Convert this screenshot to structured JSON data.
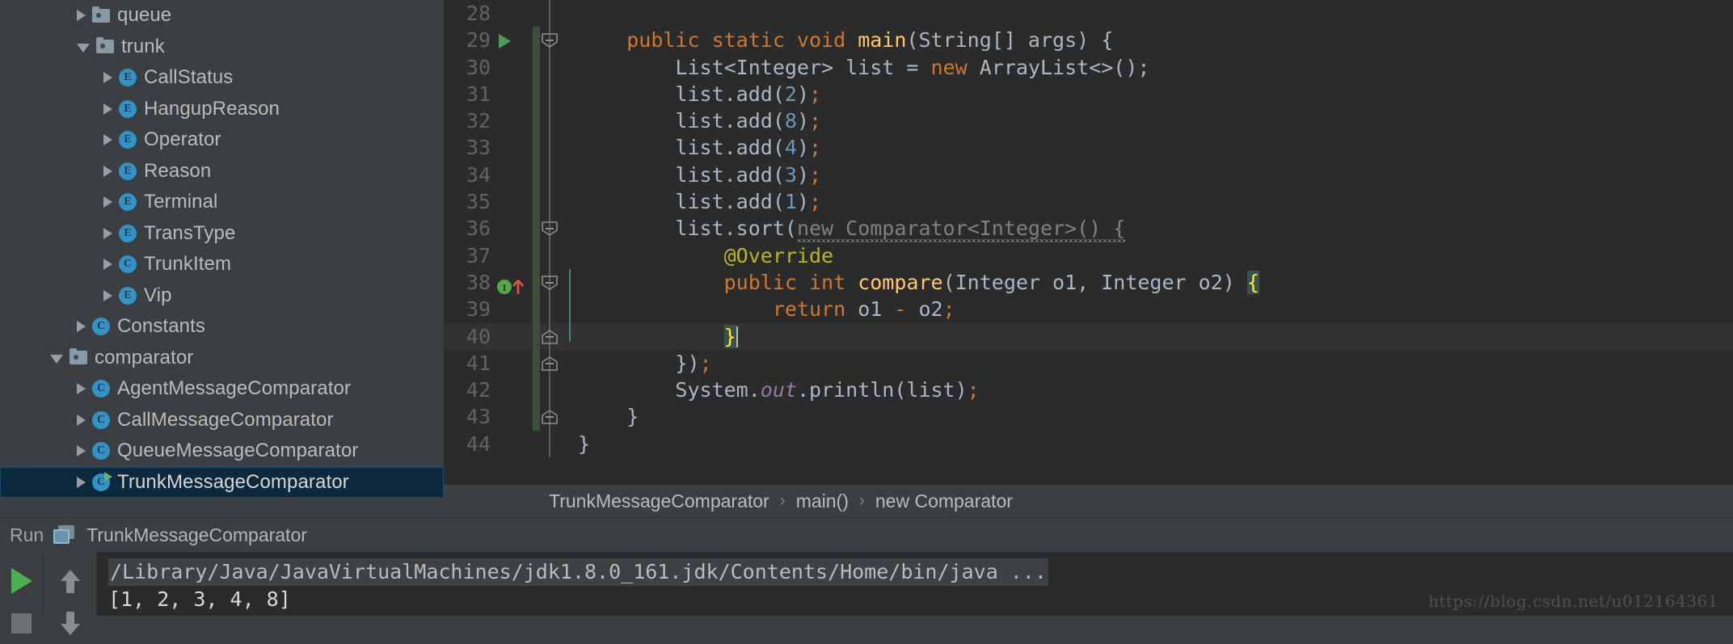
{
  "project_tree": {
    "name": "project-tree",
    "items": [
      {
        "label": "queue",
        "icon": "folder-icon",
        "arrow": "collapsed",
        "indent": 1,
        "selected": false
      },
      {
        "label": "trunk",
        "icon": "folder-icon",
        "arrow": "expanded",
        "indent": 1,
        "selected": false
      },
      {
        "label": "CallStatus",
        "icon": "enum-icon-e",
        "arrow": "collapsed",
        "indent": 2,
        "selected": false
      },
      {
        "label": "HangupReason",
        "icon": "enum-icon-e",
        "arrow": "collapsed",
        "indent": 2,
        "selected": false
      },
      {
        "label": "Operator",
        "icon": "enum-icon-e",
        "arrow": "collapsed",
        "indent": 2,
        "selected": false
      },
      {
        "label": "Reason",
        "icon": "enum-icon-e",
        "arrow": "collapsed",
        "indent": 2,
        "selected": false
      },
      {
        "label": "Terminal",
        "icon": "enum-icon-e",
        "arrow": "collapsed",
        "indent": 2,
        "selected": false
      },
      {
        "label": "TransType",
        "icon": "enum-icon-e",
        "arrow": "collapsed",
        "indent": 2,
        "selected": false
      },
      {
        "label": "TrunkItem",
        "icon": "class-icon-c",
        "arrow": "collapsed",
        "indent": 2,
        "selected": false
      },
      {
        "label": "Vip",
        "icon": "enum-icon-e",
        "arrow": "collapsed",
        "indent": 2,
        "selected": false
      },
      {
        "label": "Constants",
        "icon": "class-icon-c",
        "arrow": "collapsed",
        "indent": 1,
        "selected": false
      },
      {
        "label": "comparator",
        "icon": "folder-icon",
        "arrow": "expanded",
        "indent": 0,
        "selected": false
      },
      {
        "label": "AgentMessageComparator",
        "icon": "class-icon-c",
        "arrow": "collapsed",
        "indent": 1,
        "selected": false
      },
      {
        "label": "CallMessageComparator",
        "icon": "class-icon-c",
        "arrow": "collapsed",
        "indent": 1,
        "selected": false
      },
      {
        "label": "QueueMessageComparator",
        "icon": "class-icon-c",
        "arrow": "collapsed",
        "indent": 1,
        "selected": false
      },
      {
        "label": "TrunkMessageComparator",
        "icon": "class-icon-c-runnable",
        "arrow": "collapsed",
        "indent": 1,
        "selected": true
      }
    ]
  },
  "editor": {
    "name": "code-editor",
    "language": "java",
    "current_line": 40,
    "lines": [
      {
        "num": "28",
        "tokens": []
      },
      {
        "num": "29",
        "gutter": [
          "run-arrow-icon",
          "fold-open-icon"
        ],
        "tokens": [
          {
            "t": "    ",
            "c": "d"
          },
          {
            "t": "public static void ",
            "c": "k"
          },
          {
            "t": "main",
            "c": "fn"
          },
          {
            "t": "(String[] args) {",
            "c": "d"
          }
        ]
      },
      {
        "num": "30",
        "tokens": [
          {
            "t": "        List<Integer> list = ",
            "c": "d"
          },
          {
            "t": "new ",
            "c": "k"
          },
          {
            "t": "ArrayList<>();",
            "c": "d"
          }
        ]
      },
      {
        "num": "31",
        "tokens": [
          {
            "t": "        list.add(",
            "c": "d"
          },
          {
            "t": "2",
            "c": "num"
          },
          {
            "t": ")",
            "c": "d"
          },
          {
            "t": ";",
            "c": "k"
          }
        ]
      },
      {
        "num": "32",
        "tokens": [
          {
            "t": "        list.add(",
            "c": "d"
          },
          {
            "t": "8",
            "c": "num"
          },
          {
            "t": ")",
            "c": "d"
          },
          {
            "t": ";",
            "c": "k"
          }
        ]
      },
      {
        "num": "33",
        "tokens": [
          {
            "t": "        list.add(",
            "c": "d"
          },
          {
            "t": "4",
            "c": "num"
          },
          {
            "t": ")",
            "c": "d"
          },
          {
            "t": ";",
            "c": "k"
          }
        ]
      },
      {
        "num": "34",
        "tokens": [
          {
            "t": "        list.add(",
            "c": "d"
          },
          {
            "t": "3",
            "c": "num"
          },
          {
            "t": ")",
            "c": "d"
          },
          {
            "t": ";",
            "c": "k"
          }
        ]
      },
      {
        "num": "35",
        "tokens": [
          {
            "t": "        list.add(",
            "c": "d"
          },
          {
            "t": "1",
            "c": "num"
          },
          {
            "t": ")",
            "c": "d"
          },
          {
            "t": ";",
            "c": "k"
          }
        ]
      },
      {
        "num": "36",
        "gutter": [
          "fold-open-icon"
        ],
        "tokens": [
          {
            "t": "        list.sort(",
            "c": "d"
          },
          {
            "t": "new Comparator<Integer>() {",
            "c": "gr",
            "squiggle": true
          }
        ]
      },
      {
        "num": "37",
        "tokens": [
          {
            "t": "            ",
            "c": "d"
          },
          {
            "t": "@Override",
            "c": "an"
          }
        ]
      },
      {
        "num": "38",
        "gutter": [
          "implements-override-icon",
          "fold-open-icon"
        ],
        "tokens": [
          {
            "t": "            ",
            "c": "d"
          },
          {
            "t": "public int ",
            "c": "k"
          },
          {
            "t": "compare",
            "c": "fn"
          },
          {
            "t": "(Integer o1, Integer o2) ",
            "c": "d"
          },
          {
            "t": "{",
            "c": "brace-hl"
          }
        ]
      },
      {
        "num": "39",
        "tokens": [
          {
            "t": "                ",
            "c": "d"
          },
          {
            "t": "return ",
            "c": "k"
          },
          {
            "t": "o1 ",
            "c": "d"
          },
          {
            "t": "-",
            "c": "k"
          },
          {
            "t": " o2",
            "c": "d"
          },
          {
            "t": ";",
            "c": "k"
          }
        ]
      },
      {
        "num": "40",
        "gutter": [
          "fold-close-icon"
        ],
        "current": true,
        "cursor": true,
        "tokens": [
          {
            "t": "            ",
            "c": "d"
          },
          {
            "t": "}",
            "c": "brace-hl"
          }
        ]
      },
      {
        "num": "41",
        "gutter": [
          "fold-close-icon"
        ],
        "tokens": [
          {
            "t": "        })",
            "c": "d"
          },
          {
            "t": ";",
            "c": "k"
          }
        ]
      },
      {
        "num": "42",
        "tokens": [
          {
            "t": "        System.",
            "c": "d"
          },
          {
            "t": "out",
            "c": "st"
          },
          {
            "t": ".println(list)",
            "c": "d"
          },
          {
            "t": ";",
            "c": "k"
          }
        ]
      },
      {
        "num": "43",
        "gutter": [
          "fold-close-icon"
        ],
        "tokens": [
          {
            "t": "    }",
            "c": "d"
          }
        ]
      },
      {
        "num": "44",
        "tokens": [
          {
            "t": "}",
            "c": "d"
          }
        ]
      }
    ]
  },
  "breadcrumb": {
    "name": "editor-breadcrumb",
    "separator": "›",
    "items": [
      "TrunkMessageComparator",
      "main()",
      "new Comparator"
    ]
  },
  "run_window": {
    "name": "run-tool-window",
    "header_label": "Run",
    "header_title": "TrunkMessageComparator",
    "toolbar": [
      {
        "name": "rerun-button",
        "icon": "play-icon"
      },
      {
        "name": "stop-button",
        "icon": "stop-icon"
      },
      {
        "name": "scroll-up-button",
        "icon": "arrow-up-icon"
      },
      {
        "name": "scroll-down-button",
        "icon": "arrow-down-icon"
      }
    ],
    "console": [
      {
        "text": "/Library/Java/JavaVirtualMachines/jdk1.8.0_161.jdk/Contents/Home/bin/java ...",
        "kind": "command"
      },
      {
        "text": "[1, 2, 3, 4, 8]",
        "kind": "output"
      }
    ]
  },
  "watermark": {
    "text": "https://blog.csdn.net/u012164361"
  },
  "colors": {
    "panel_bg": "#3c3f41",
    "editor_bg": "#2b2b2b",
    "selection_bg": "#0d293e",
    "current_line_bg": "#323232",
    "accent_blue": "#3592c4",
    "keyword_orange": "#cc7832",
    "method_yellow": "#ffc66d",
    "number_blue": "#6897bb",
    "annotation_olive": "#bbb529",
    "static_purple": "#9876aa",
    "default_text": "#a9b7c6",
    "change_bar_green": "#375239",
    "run_green": "#499c54"
  }
}
